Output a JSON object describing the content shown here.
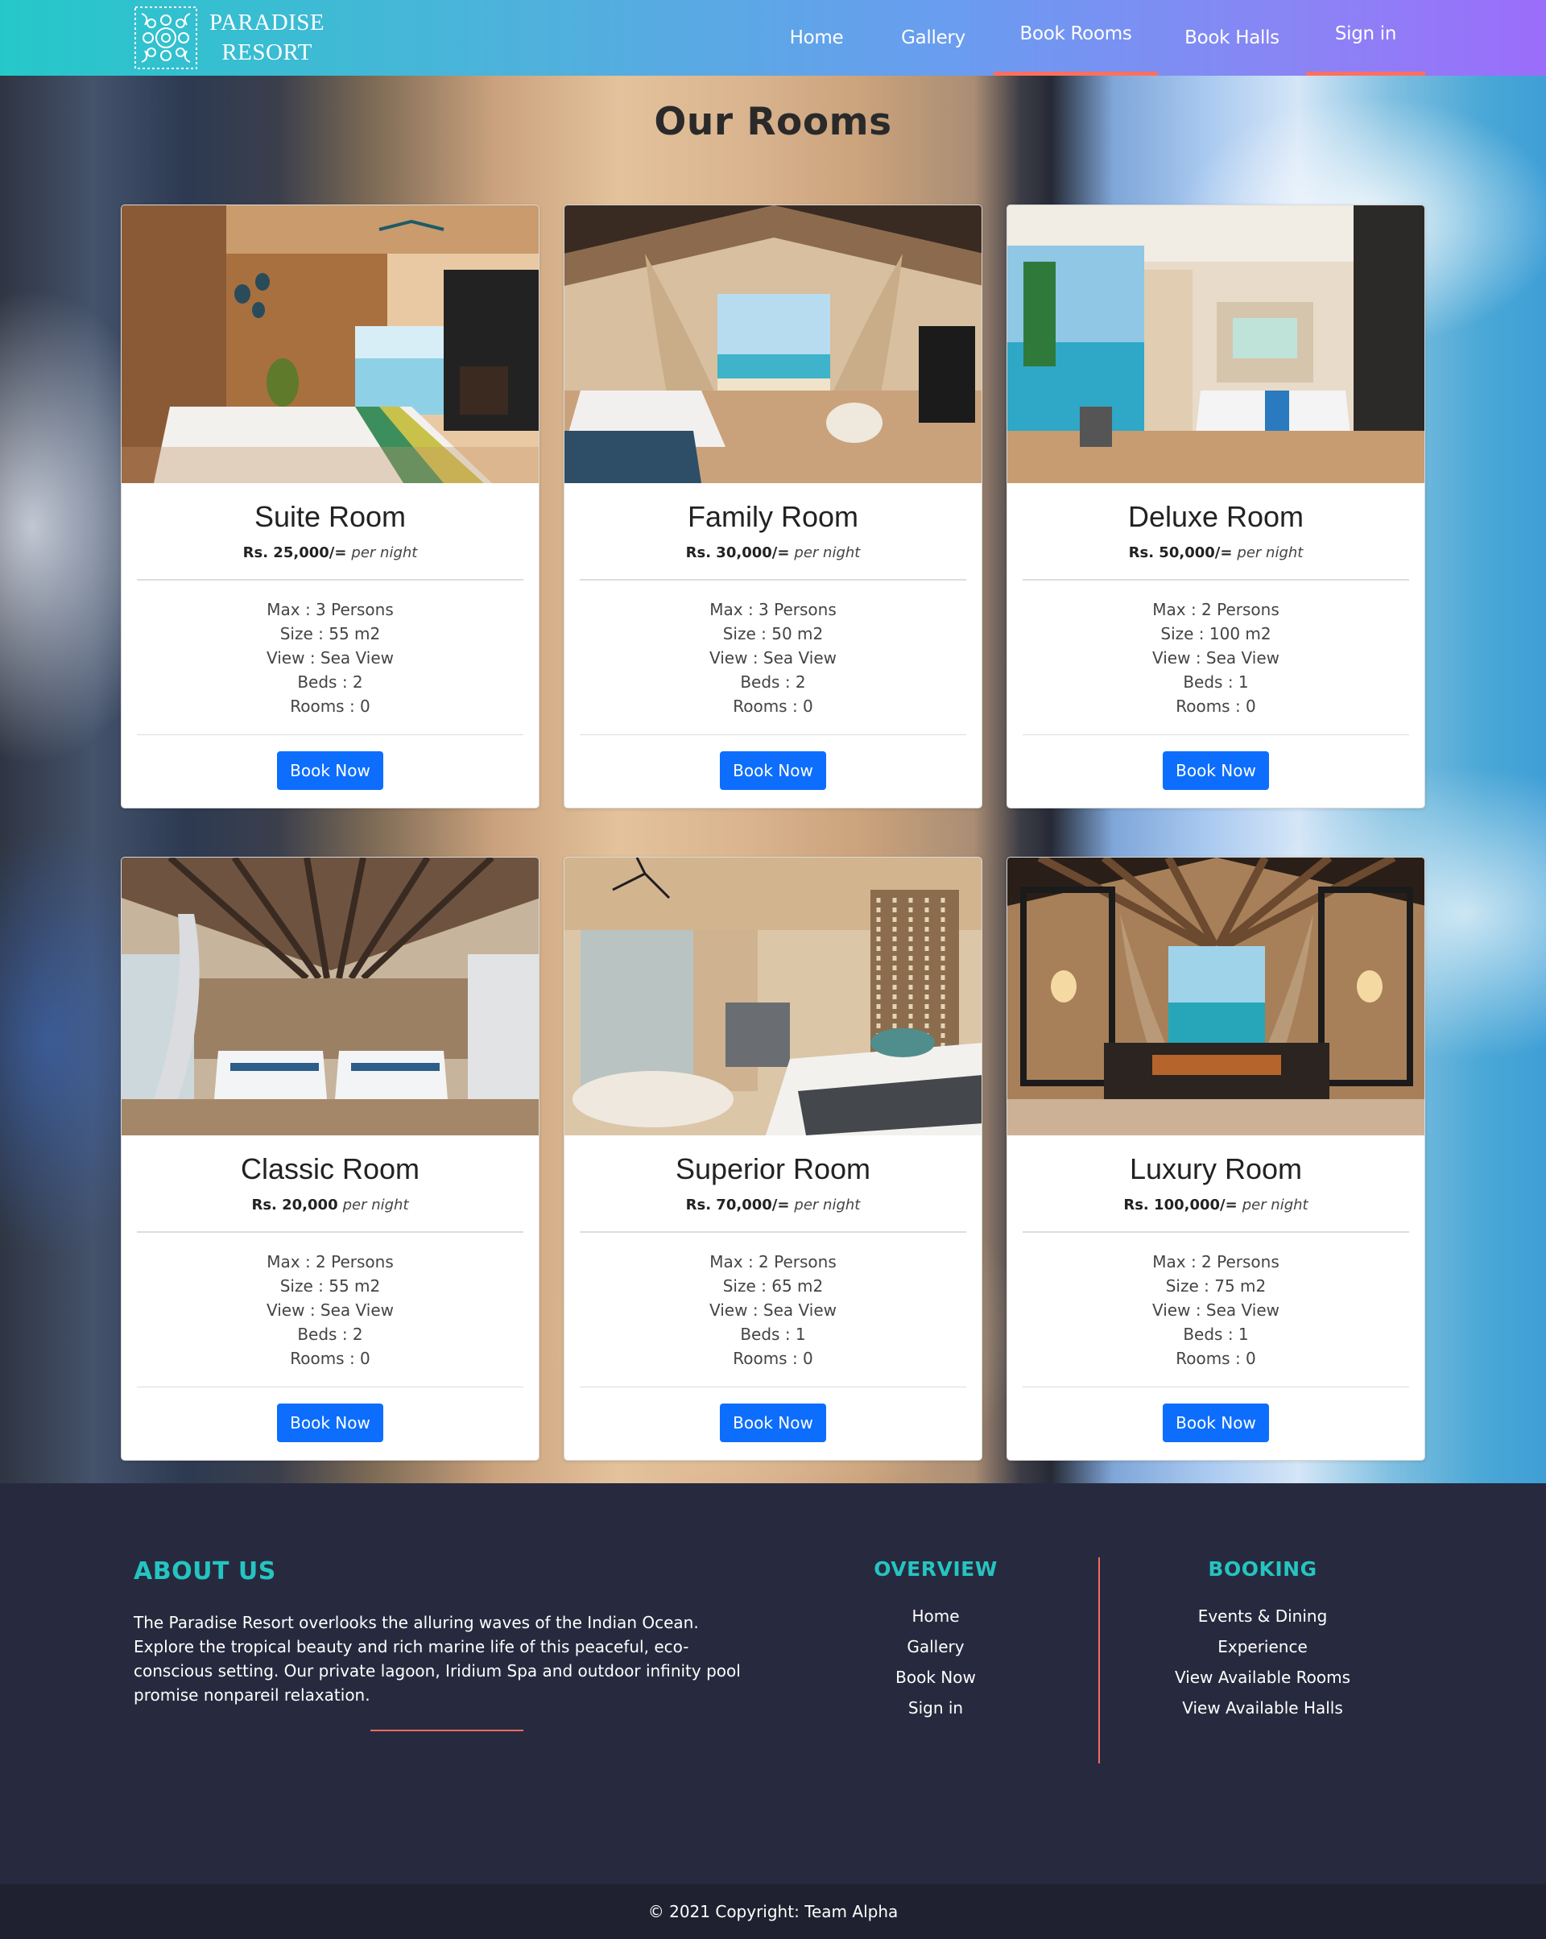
{
  "brand": {
    "name_line1": "PARADISE",
    "name_line2": "RESORT",
    "logo_icon": "ornament-logo-icon"
  },
  "nav": [
    {
      "label": "Home"
    },
    {
      "label": "Gallery"
    },
    {
      "label": "Book Rooms",
      "active": true
    },
    {
      "label": "Book Halls"
    },
    {
      "label": "Sign in"
    }
  ],
  "page_title": "Our Rooms",
  "rooms": [
    {
      "title": "Suite Room",
      "price": "Rs. 25,000/=",
      "per": "per night",
      "max": "Max : 3 Persons",
      "size": "Size : 55 m2",
      "view": "View : Sea View",
      "beds": "Beds : 2",
      "rooms": "Rooms : 0",
      "button": "Book Now"
    },
    {
      "title": "Family Room",
      "price": "Rs. 30,000/=",
      "per": "per night",
      "max": "Max : 3 Persons",
      "size": "Size : 50 m2",
      "view": "View : Sea View",
      "beds": "Beds : 2",
      "rooms": "Rooms : 0",
      "button": "Book Now"
    },
    {
      "title": "Deluxe Room",
      "price": "Rs. 50,000/=",
      "per": "per night",
      "max": "Max : 2 Persons",
      "size": "Size : 100 m2",
      "view": "View : Sea View",
      "beds": "Beds : 1",
      "rooms": "Rooms : 0",
      "button": "Book Now"
    },
    {
      "title": "Classic Room",
      "price": "Rs. 20,000",
      "per": "per night",
      "max": "Max : 2 Persons",
      "size": "Size : 55 m2",
      "view": "View : Sea View",
      "beds": "Beds : 2",
      "rooms": "Rooms : 0",
      "button": "Book Now"
    },
    {
      "title": "Superior Room",
      "price": "Rs. 70,000/=",
      "per": "per night",
      "max": "Max : 2 Persons",
      "size": "Size : 65 m2",
      "view": "View : Sea View",
      "beds": "Beds : 1",
      "rooms": "Rooms : 0",
      "button": "Book Now"
    },
    {
      "title": "Luxury Room",
      "price": "Rs. 100,000/=",
      "per": "per night",
      "max": "Max : 2 Persons",
      "size": "Size : 75 m2",
      "view": "View : Sea View",
      "beds": "Beds : 1",
      "rooms": "Rooms : 0",
      "button": "Book Now"
    }
  ],
  "footer": {
    "about_title": "ABOUT US",
    "about_text": "The Paradise Resort overlooks the alluring waves of the Indian Ocean. Explore the tropical beauty and rich marine life of this peaceful, eco-conscious setting. Our private lagoon, Iridium Spa and outdoor infinity pool promise nonpareil relaxation.",
    "overview_title": "OVERVIEW",
    "overview_links": [
      "Home",
      "Gallery",
      "Book Now",
      "Sign in"
    ],
    "booking_title": "BOOKING",
    "booking_links": [
      "Events & Dining",
      "Experience",
      "View Available Rooms",
      "View Available Halls"
    ],
    "copyright": "© 2021 Copyright: Team Alpha"
  },
  "colors": {
    "accent_teal": "#25c4c1",
    "accent_coral": "#f06c61",
    "button_blue": "#0d6efd",
    "footer_bg": "#272a3e"
  }
}
